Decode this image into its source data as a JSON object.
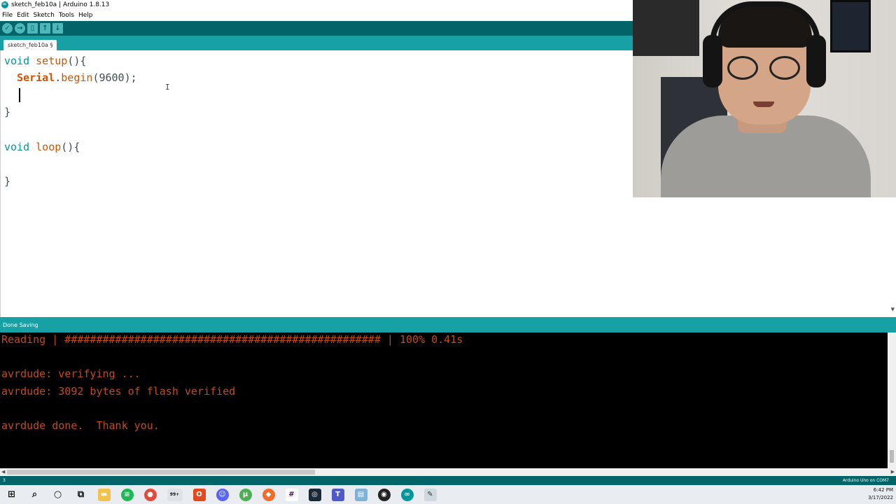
{
  "window": {
    "title": "sketch_feb10a | Arduino 1.8.13"
  },
  "menu": [
    "File",
    "Edit",
    "Sketch",
    "Tools",
    "Help"
  ],
  "toolbar": {
    "buttons": [
      "verify-icon",
      "upload-icon",
      "new-icon",
      "open-icon",
      "save-icon"
    ]
  },
  "tab": {
    "label": "sketch_feb10a §"
  },
  "editor": {
    "lines": [
      "void setup(){",
      "  Serial.begin(9600);",
      "",
      "}",
      "",
      "void loop(){",
      "",
      "",
      "}"
    ]
  },
  "status": {
    "message": "Done Saving"
  },
  "console": {
    "lines": [
      "Reading | ################################################## | 100% 0.41s",
      "",
      "avrdude: verifying ...",
      "avrdude: 3092 bytes of flash verified",
      "",
      "avrdude done.  Thank you."
    ]
  },
  "footer": {
    "line_number": "3",
    "board": "Arduino Uno on COM7"
  },
  "taskbar": {
    "mail_badge": "99+",
    "time": "6:42 PM",
    "date": "3/17/2022"
  }
}
